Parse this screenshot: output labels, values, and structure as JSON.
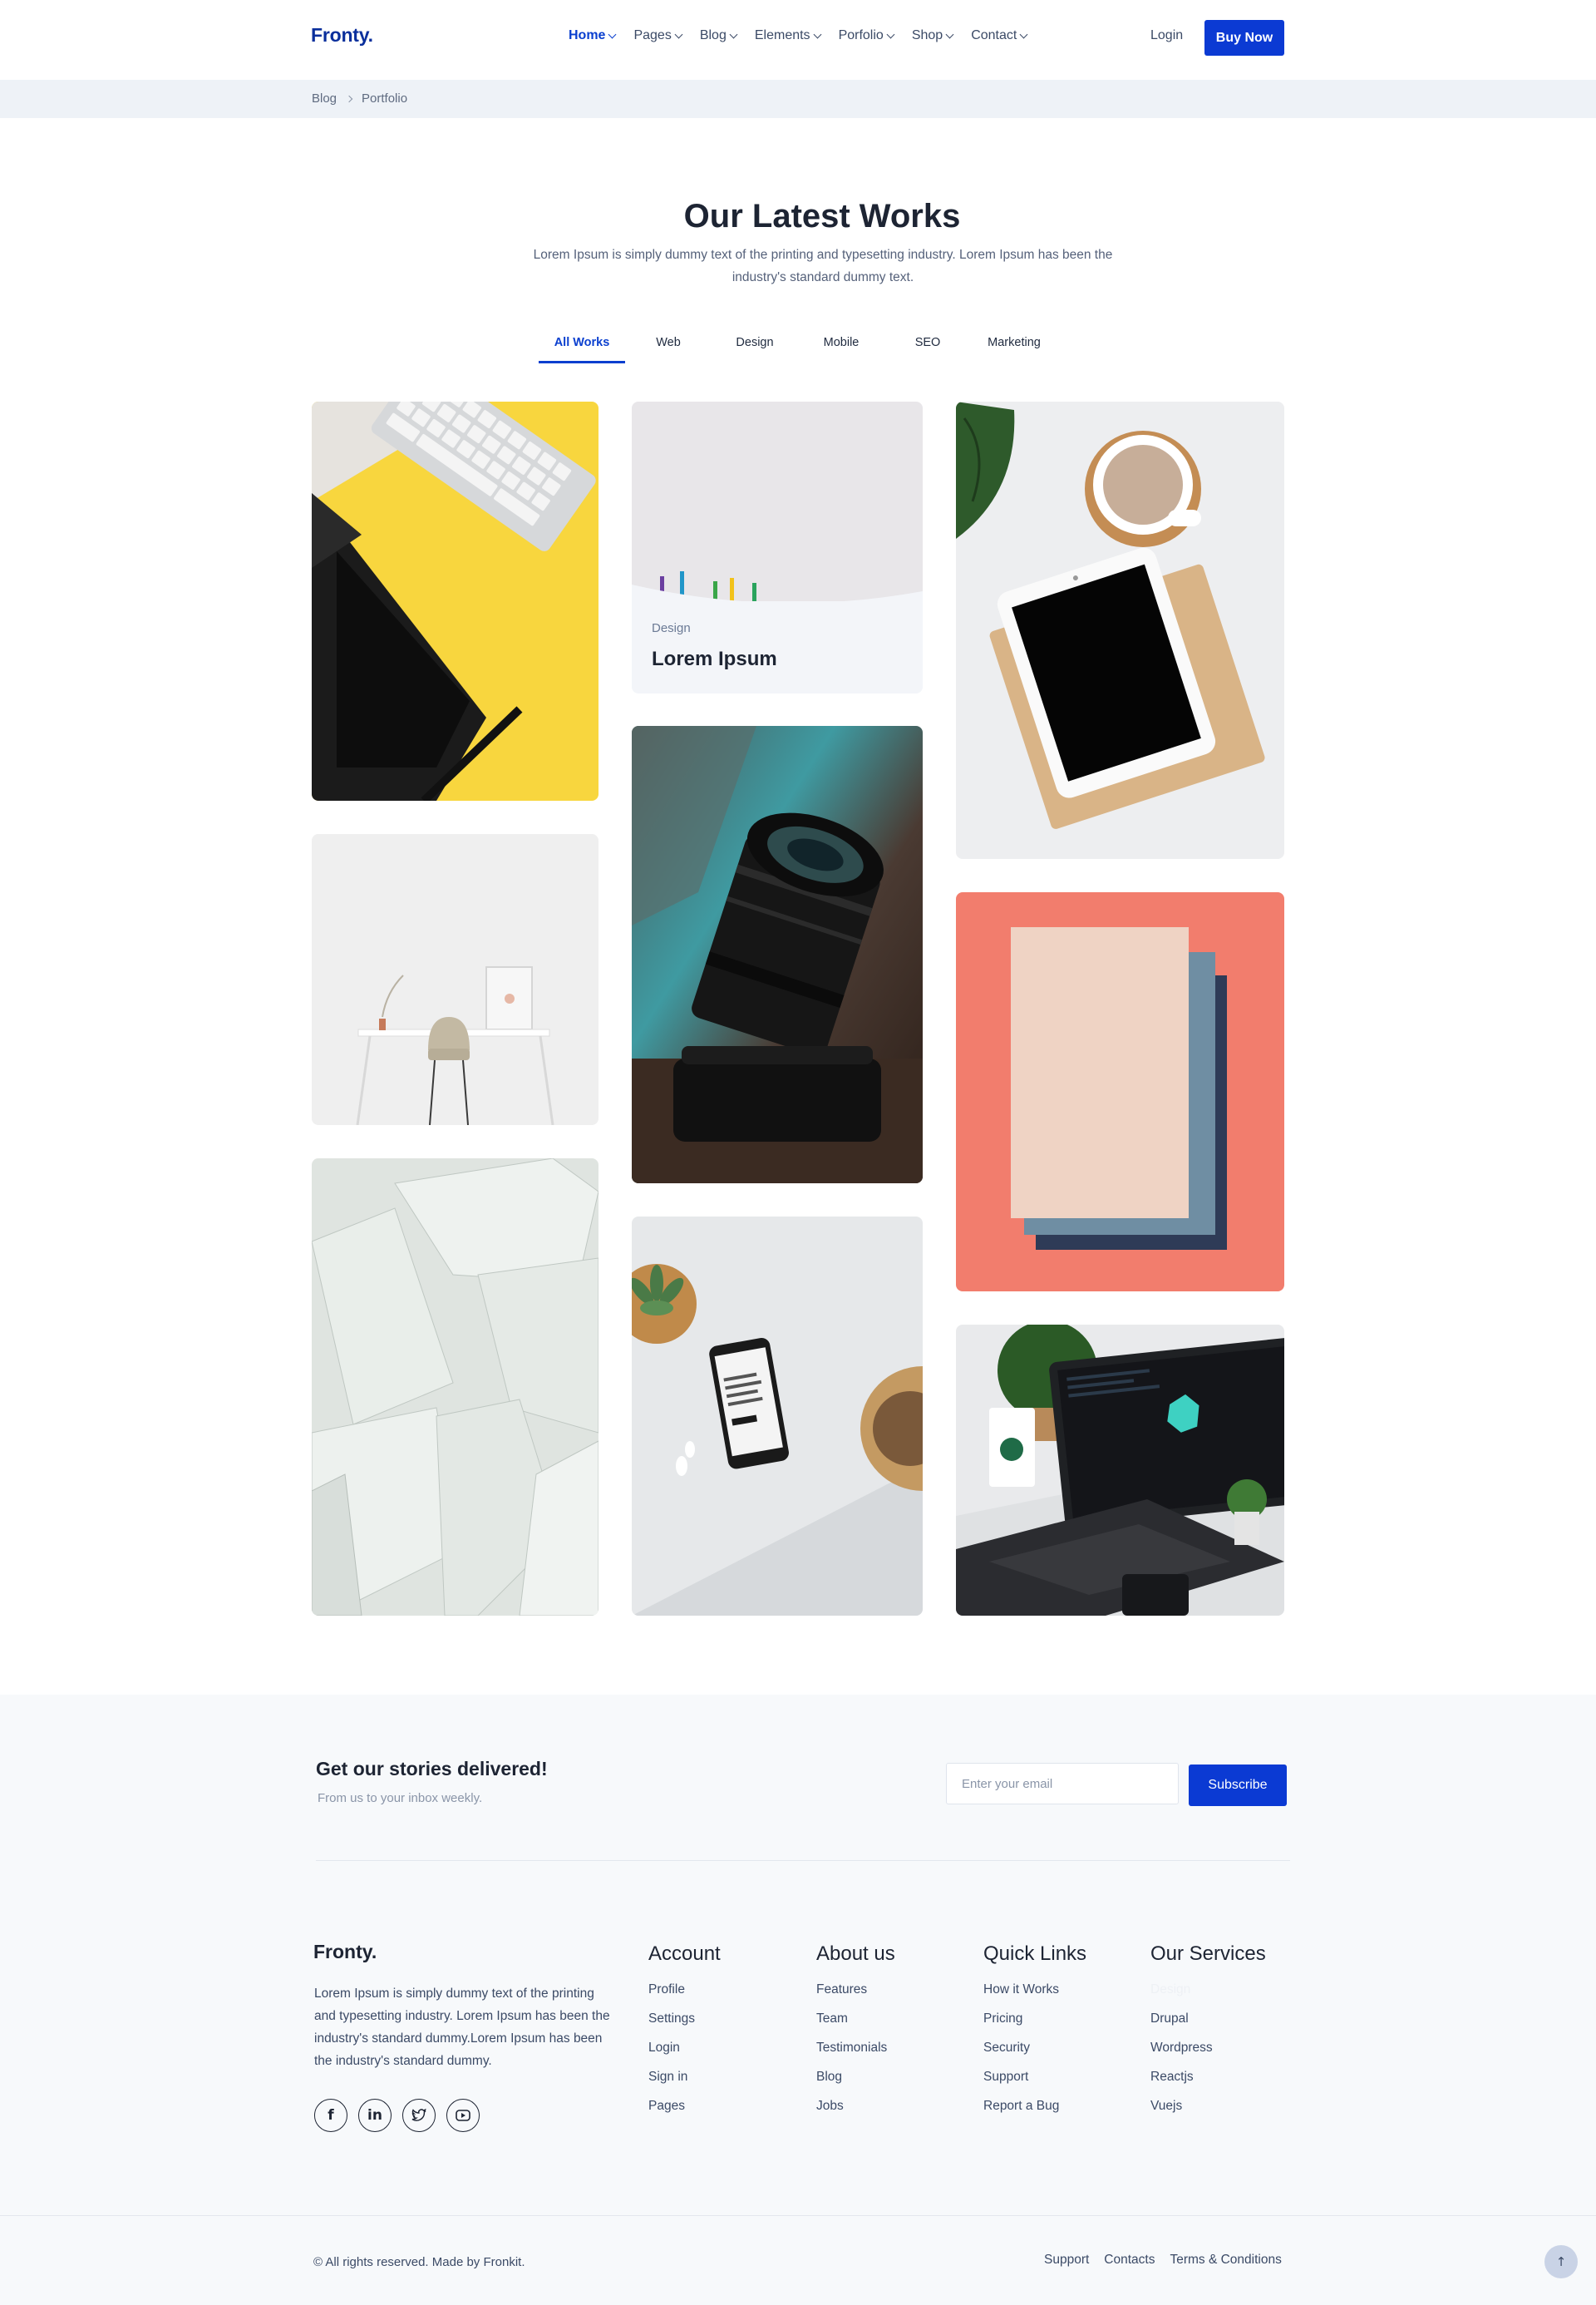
{
  "header": {
    "logo": "Fronty.",
    "nav": [
      "Home",
      "Pages",
      "Blog",
      "Elements",
      "Porfolio",
      "Shop",
      "Contact"
    ],
    "login": "Login",
    "buy": "Buy Now"
  },
  "breadcrumb": [
    "Blog",
    "Portfolio"
  ],
  "section": {
    "title": "Our Latest Works",
    "description": "Lorem Ipsum is simply dummy text of the printing and typesetting industry. Lorem Ipsum has been the industry's standard dummy text."
  },
  "tabs": [
    "All Works",
    "Web",
    "Design",
    "Mobile",
    "SEO",
    "Marketing"
  ],
  "featured": {
    "category": "Design",
    "title": "Lorem Ipsum"
  },
  "newsletter": {
    "title": "Get our stories delivered!",
    "subtitle": "From us to your inbox weekly.",
    "placeholder": "Enter your email",
    "button": "Subscribe"
  },
  "footer": {
    "logo": "Fronty.",
    "description": "Lorem Ipsum is simply dummy text of the printing and typesetting industry. Lorem Ipsum has been the industry's standard dummy.Lorem Ipsum has been the industry's standard dummy.",
    "socials": [
      "facebook-icon",
      "linkedin-icon",
      "twitter-icon",
      "youtube-icon"
    ],
    "columns": [
      {
        "title": "Account",
        "items": [
          "Profile",
          "Settings",
          "Login",
          "Sign in",
          "Pages"
        ]
      },
      {
        "title": "About us",
        "items": [
          "Features",
          "Team",
          "Testimonials",
          "Blog",
          "Jobs"
        ]
      },
      {
        "title": "Quick Links",
        "items": [
          "How it Works",
          "Pricing",
          "Security",
          "Support",
          "Report a Bug"
        ]
      },
      {
        "title": "Our Services",
        "items": [
          "Design",
          "Drupal",
          "Wordpress",
          "Reactjs",
          "Vuejs"
        ]
      }
    ],
    "copyright": "© All rights reserved. Made by Fronkit.",
    "bottom_links": [
      "Support",
      "Contacts",
      "Terms & Conditions"
    ]
  },
  "colors": {
    "brand": "#0b3ad3",
    "text": "#1d2433",
    "muted": "#55617a"
  }
}
